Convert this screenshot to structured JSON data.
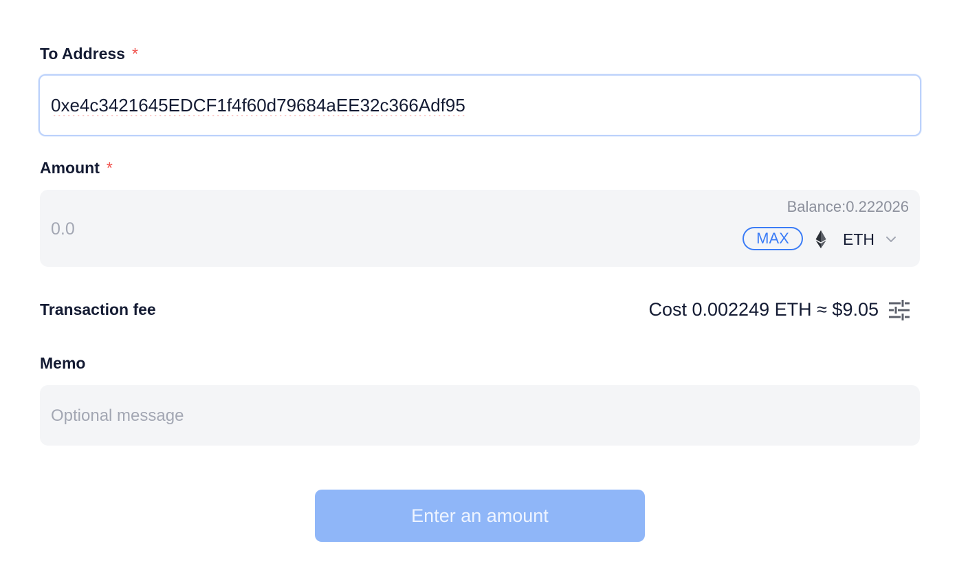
{
  "to_address": {
    "label": "To Address",
    "required_mark": "*",
    "value": "0xe4c3421645EDCF1f4f60d79684aEE32c366Adf95"
  },
  "amount": {
    "label": "Amount",
    "required_mark": "*",
    "placeholder": "0.0",
    "balance": "Balance:0.222026",
    "max_label": "MAX",
    "token": {
      "symbol": "ETH",
      "icon": "ethereum-icon"
    }
  },
  "fee": {
    "label": "Transaction fee",
    "cost": "Cost 0.002249 ETH ≈ $9.05",
    "settings_icon": "sliders-icon"
  },
  "memo": {
    "label": "Memo",
    "placeholder": "Optional message"
  },
  "submit": {
    "label": "Enter an amount",
    "state": "disabled"
  },
  "colors": {
    "accent": "#3b7cf6",
    "required": "#f0524d",
    "button_disabled": "#8fb6f8",
    "input_bg": "#f4f5f7",
    "focus_border": "#bcd2fb"
  }
}
